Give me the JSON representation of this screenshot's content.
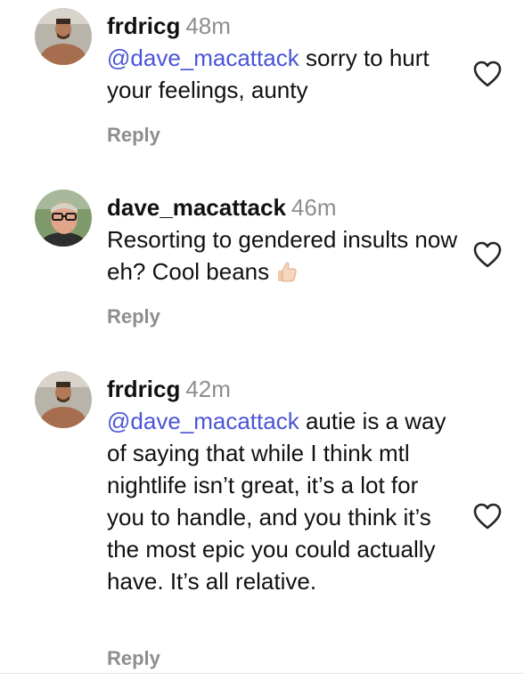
{
  "comments": [
    {
      "username": "frdricg",
      "time": "48m",
      "mention": "@dave_macattack",
      "text": " sorry to hurt your feelings, aunty",
      "reply_label": "Reply"
    },
    {
      "username": "dave_macattack",
      "time": "46m",
      "text": "Resorting to gendered insults now eh? Cool beans",
      "reply_label": "Reply"
    },
    {
      "username": "frdricg",
      "time": "42m",
      "mention": "@dave_macattack",
      "text": " autie is a way of saying that while I think mtl nightlife isn’t great, it’s a lot for you to handle, and you think it’s the most epic you could actually have. It’s all relative.",
      "reply_label": "Reply"
    }
  ],
  "icons": {
    "like": "heart-icon",
    "emoji": "thumbs-up-icon"
  },
  "colors": {
    "mention": "#4a55d6",
    "muted": "#8e8e8e",
    "text": "#111111"
  }
}
